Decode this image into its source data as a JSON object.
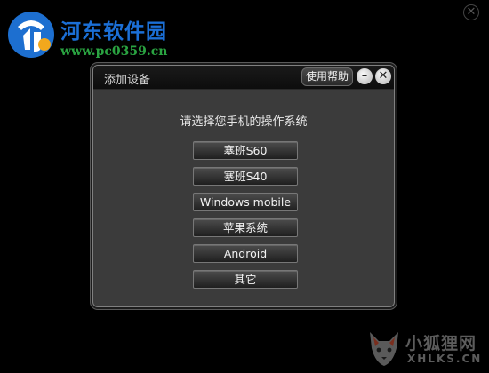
{
  "watermark": {
    "site_name": "河东软件园",
    "site_url": "www.pc0359.cn",
    "logo_icon": "hedong-logo-icon",
    "brand_colors": {
      "title": "#1b6fd6",
      "url": "#2aa341"
    }
  },
  "outer_window": {
    "close_icon": "close-icon",
    "close_glyph": "✕"
  },
  "dialog": {
    "title": "添加设备",
    "help_label": "使用帮助",
    "minimize_glyph": "–",
    "close_glyph": "✕",
    "prompt": "请选择您手机的操作系统",
    "os_options": [
      "塞班S60",
      "塞班S40",
      "Windows mobile",
      "苹果系统",
      "Android",
      "其它"
    ]
  },
  "corner_watermark": {
    "title": "小狐狸网",
    "url": "XHLKS.CN",
    "icon": "fox-icon"
  }
}
